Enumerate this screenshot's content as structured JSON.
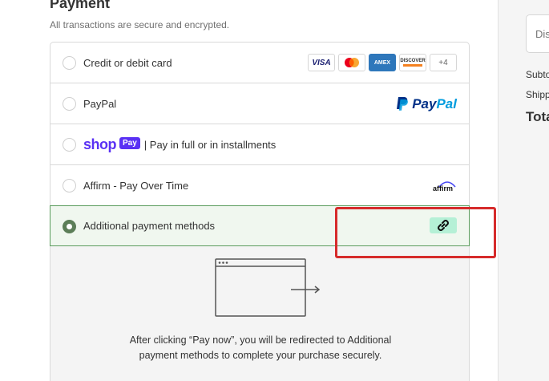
{
  "payment": {
    "title": "Payment",
    "subtitle": "All transactions are secure and encrypted.",
    "methods": [
      {
        "label": "Credit or debit card",
        "selected": false,
        "card_brands": [
          "VISA",
          "Mastercard",
          "AMEX",
          "DISCOVER"
        ],
        "more_count": "+4"
      },
      {
        "label": "PayPal",
        "selected": false,
        "logo_text_1": "Pay",
        "logo_text_2": "Pal"
      },
      {
        "logo_shop": "shop",
        "logo_pay": "Pay",
        "label": "| Pay in full or in installments",
        "selected": false
      },
      {
        "label": "Affirm - Pay Over Time",
        "selected": false,
        "logo_text": "affirm"
      },
      {
        "label": "Additional payment methods",
        "selected": true,
        "icon": "link-icon"
      }
    ],
    "redirect_message": "After clicking “Pay now”, you will be redirected to Additional payment methods to complete your purchase securely."
  },
  "summary": {
    "discount_placeholder": "Disc",
    "subtotal_label": "Subto",
    "shipping_label": "Shipp",
    "total_label": "Tota"
  },
  "colors": {
    "selected_border": "#5b9c5d",
    "selected_bg": "#f0f7ef",
    "highlight": "#d62b2b",
    "shop_purple": "#5a31f4",
    "link_green": "#b5f0d6"
  }
}
